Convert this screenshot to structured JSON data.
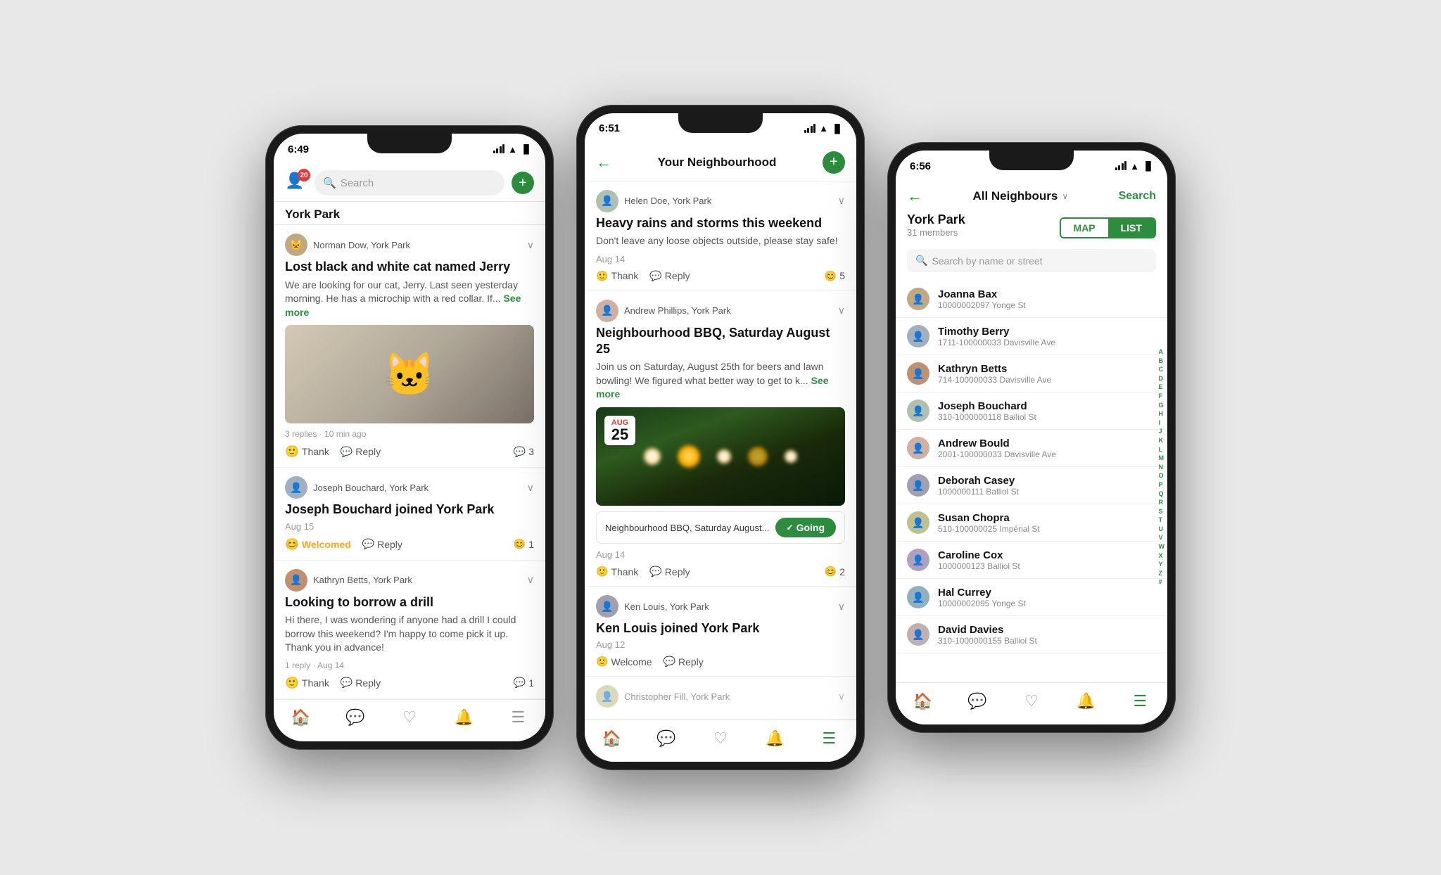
{
  "phone1": {
    "status": {
      "time": "6:49",
      "signal": true,
      "wifi": true,
      "battery": true
    },
    "header": {
      "search_placeholder": "Search",
      "neighbourhood": "York Park"
    },
    "posts": [
      {
        "id": "post1",
        "author": "Norman Dow, York Park",
        "title": "Lost black and white cat named Jerry",
        "body": "We are looking for our cat, Jerry. Last seen yesterday morning. He has a microchip with a red collar. If...",
        "see_more": "See more",
        "meta": "3 replies · 10 min ago",
        "has_image": true,
        "thank_label": "Thank",
        "reply_label": "Reply",
        "count": "3"
      },
      {
        "id": "post2",
        "author": "Joseph Bouchard, York Park",
        "title": "Joseph Bouchard joined York Park",
        "date": "Aug 15",
        "welcomed_label": "Welcomed",
        "reply_label": "Reply",
        "count": "1"
      },
      {
        "id": "post3",
        "author": "Kathryn Betts, York Park",
        "title": "Looking to borrow a drill",
        "body": "Hi there, I was wondering if anyone had a drill I could borrow this weekend? I'm happy to come pick it up. Thank you in advance!",
        "meta": "1 reply · Aug 14",
        "thank_label": "Thank",
        "reply_label": "Reply",
        "count": "1"
      }
    ],
    "tabs": [
      "home",
      "chat",
      "heart",
      "bell",
      "menu"
    ]
  },
  "phone2": {
    "status": {
      "time": "6:51"
    },
    "header": {
      "title": "Your Neighbourhood"
    },
    "posts": [
      {
        "id": "p2-1",
        "author": "Helen Doe, York Park",
        "title": "Heavy rains and storms this weekend",
        "body": "Don't leave any loose objects outside, please stay safe!",
        "date": "Aug 14",
        "thank_label": "Thank",
        "reply_label": "Reply",
        "count": "5"
      },
      {
        "id": "p2-2",
        "author": "Andrew Phillips, York Park",
        "title": "Neighbourhood BBQ, Saturday August 25",
        "body": "Join us on Saturday, August 25th for beers and lawn bowling! We figured what better way to get to k...",
        "see_more": "See more",
        "has_image": true,
        "event_month": "Aug",
        "event_day": "25",
        "event_title": "Neighbourhood BBQ, Saturday August...",
        "going_label": "Going",
        "date": "Aug 14",
        "thank_label": "Thank",
        "reply_label": "Reply",
        "count": "2"
      },
      {
        "id": "p2-3",
        "author": "Ken Louis, York Park",
        "title": "Ken Louis joined York Park",
        "date": "Aug 12",
        "welcome_label": "Welcome",
        "reply_label": "Reply"
      },
      {
        "id": "p2-4",
        "author": "Christopher Fill, York Park",
        "title": ""
      }
    ],
    "tabs": [
      "home",
      "chat",
      "heart",
      "bell",
      "menu"
    ]
  },
  "phone3": {
    "status": {
      "time": "6:56"
    },
    "header": {
      "dropdown": "All Neighbours",
      "search_label": "Search",
      "location": "York Park",
      "members": "31 members",
      "map_label": "MAP",
      "list_label": "LIST",
      "search_placeholder": "Search by name or street"
    },
    "neighbours": [
      {
        "name": "Joanna Bax",
        "address": "10000002097 Yonge St"
      },
      {
        "name": "Timothy Berry",
        "address": "1711-100000033 Davisville Ave"
      },
      {
        "name": "Kathryn Betts",
        "address": "714-100000033 Davisville Ave"
      },
      {
        "name": "Joseph Bouchard",
        "address": "310-1000000118 Balliol St"
      },
      {
        "name": "Andrew Bould",
        "address": "2001-100000033 Davisville Ave"
      },
      {
        "name": "Deborah Casey",
        "address": "1000000111 Balliol St"
      },
      {
        "name": "Susan Chopra",
        "address": "510-100000025 Impérial St"
      },
      {
        "name": "Caroline Cox",
        "address": "1000000123 Balliol St"
      },
      {
        "name": "Hal Currey",
        "address": "10000002095 Yonge St"
      },
      {
        "name": "David Davies",
        "address": "310-1000000155 Balliol St"
      }
    ],
    "alphabet": [
      "A",
      "B",
      "C",
      "D",
      "E",
      "F",
      "G",
      "H",
      "I",
      "J",
      "K",
      "L",
      "M",
      "N",
      "O",
      "P",
      "Q",
      "R",
      "S",
      "T",
      "U",
      "V",
      "W",
      "X",
      "Y",
      "Z",
      "#"
    ],
    "tabs": [
      "home",
      "chat",
      "heart",
      "bell",
      "menu"
    ]
  }
}
